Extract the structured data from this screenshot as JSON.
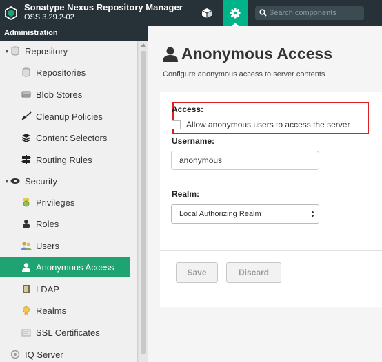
{
  "header": {
    "title": "Sonatype Nexus Repository Manager",
    "version": "OSS 3.29.2-02",
    "search_placeholder": "Search components",
    "icons": [
      "nexus-logo-icon",
      "cube-icon",
      "gear-icon",
      "search-icon"
    ],
    "colors": {
      "bar": "#263238",
      "accent": "#00b388"
    }
  },
  "sidebar": {
    "title": "Administration",
    "items": [
      {
        "label": "Repository",
        "icon": "database-icon",
        "level": 0
      },
      {
        "label": "Repositories",
        "icon": "database-icon",
        "level": 1
      },
      {
        "label": "Blob Stores",
        "icon": "hard-drive-icon",
        "level": 1
      },
      {
        "label": "Cleanup Policies",
        "icon": "broom-icon",
        "level": 1
      },
      {
        "label": "Content Selectors",
        "icon": "layers-icon",
        "level": 1
      },
      {
        "label": "Routing Rules",
        "icon": "signpost-icon",
        "level": 1
      },
      {
        "label": "Security",
        "icon": "security-icon",
        "level": 0
      },
      {
        "label": "Privileges",
        "icon": "medal-icon",
        "level": 1
      },
      {
        "label": "Roles",
        "icon": "role-icon",
        "level": 1
      },
      {
        "label": "Users",
        "icon": "users-icon",
        "level": 1
      },
      {
        "label": "Anonymous Access",
        "icon": "user-icon",
        "level": 1,
        "selected": true
      },
      {
        "label": "LDAP",
        "icon": "book-icon",
        "level": 1
      },
      {
        "label": "Realms",
        "icon": "realm-icon",
        "level": 1
      },
      {
        "label": "SSL Certificates",
        "icon": "certificate-icon",
        "level": 1
      },
      {
        "label": "IQ Server",
        "icon": "iq-icon",
        "level": 0
      }
    ],
    "selected_color": "#1fa372"
  },
  "main": {
    "title": "Anonymous Access",
    "description": "Configure anonymous access to server contents",
    "access_label": "Access:",
    "checkbox_label": "Allow anonymous users to access the server",
    "checkbox_checked": false,
    "username_label": "Username:",
    "username_value": "anonymous",
    "realm_label": "Realm:",
    "realm_value": "Local Authorizing Realm",
    "save_label": "Save",
    "discard_label": "Discard",
    "highlight_color": "#e02020"
  }
}
